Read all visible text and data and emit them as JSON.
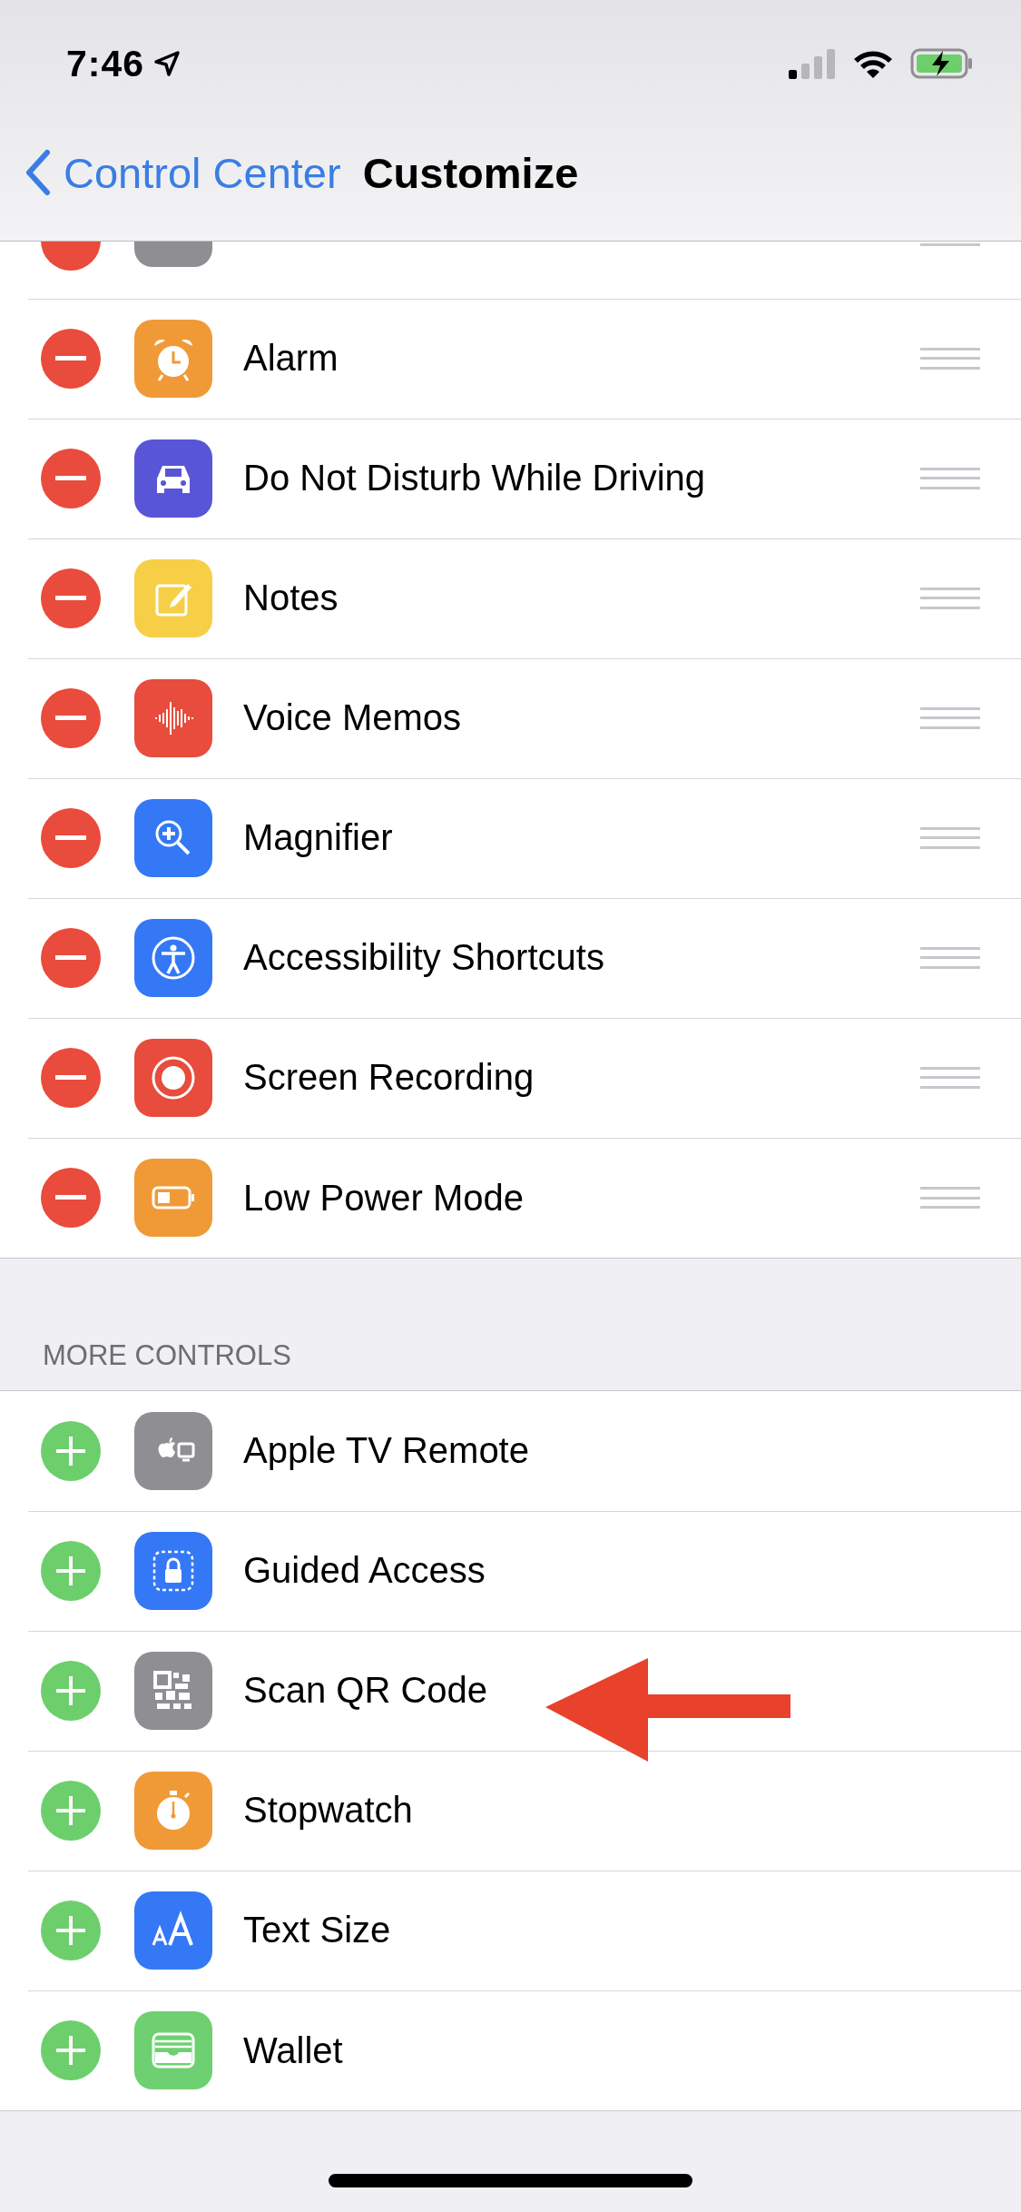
{
  "status_bar": {
    "time": "7:46"
  },
  "nav": {
    "back": "Control Center",
    "title": "Customize"
  },
  "sections": [
    {
      "items": [
        {
          "kind": "remove",
          "color": "#8e8e93",
          "marked": false
        },
        {
          "label": "Alarm",
          "kind": "remove",
          "color": "#f09a37",
          "marked": false
        },
        {
          "label": "Do Not Disturb While Driving",
          "kind": "remove",
          "color": "#5856d6",
          "marked": false
        },
        {
          "label": "Notes",
          "kind": "remove",
          "color": "#f7cf46",
          "marked": false
        },
        {
          "label": "Voice Memos",
          "kind": "remove",
          "color": "#e74c3c",
          "marked": false
        },
        {
          "label": "Magnifier",
          "kind": "remove",
          "color": "#3478f6",
          "marked": false
        },
        {
          "label": "Accessibility Shortcuts",
          "kind": "remove",
          "color": "#3478f6",
          "marked": false
        },
        {
          "label": "Screen Recording",
          "kind": "remove",
          "color": "#e74c3c",
          "marked": false
        },
        {
          "label": "Low Power Mode",
          "kind": "remove",
          "color": "#f09a37",
          "marked": false
        }
      ]
    },
    {
      "header": "MORE CONTROLS",
      "items": [
        {
          "label": "Apple TV Remote",
          "kind": "add",
          "color": "#8e8e93",
          "marked": false
        },
        {
          "label": "Guided Access",
          "kind": "add",
          "color": "#3478f6",
          "marked": false
        },
        {
          "label": "Scan QR Code",
          "kind": "add",
          "color": "#8e8e93",
          "marked": true
        },
        {
          "label": "Stopwatch",
          "kind": "add",
          "color": "#f09a37",
          "marked": false
        },
        {
          "label": "Text Size",
          "kind": "add",
          "color": "#3478f6",
          "marked": false
        },
        {
          "label": "Wallet",
          "kind": "add",
          "color": "#6ed071",
          "marked": false
        }
      ]
    }
  ]
}
